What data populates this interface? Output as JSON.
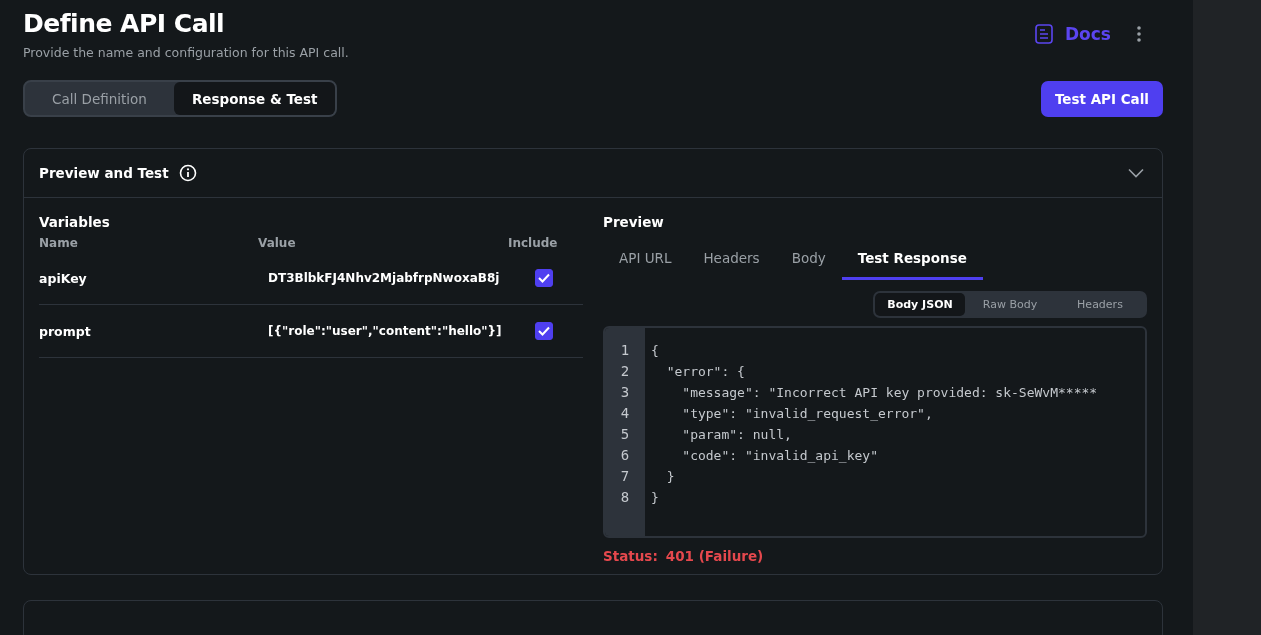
{
  "header": {
    "title": "Define API Call",
    "subtitle": "Provide the name and configuration for this API call.",
    "docs_link": "Docs"
  },
  "mode_tabs": [
    {
      "label": "Call Definition",
      "selected": false
    },
    {
      "label": "Response & Test",
      "selected": true
    }
  ],
  "test_button": "Test API Call",
  "preview_card": {
    "title": "Preview and Test",
    "expanded": true,
    "variables": {
      "title": "Variables",
      "columns": [
        "Name",
        "Value",
        "Include"
      ],
      "rows": [
        {
          "name": "apiKey",
          "value": "DT3BlbkFJ4Nhv2MjabfrpNwoxaB8j",
          "checked": true
        },
        {
          "name": "prompt",
          "value": "[{\"role\":\"user\",\"content\":\"hello\"}]",
          "checked": true
        }
      ]
    },
    "preview": {
      "title": "Preview",
      "tabs": [
        {
          "label": "API URL",
          "selected": false
        },
        {
          "label": "Headers",
          "selected": false
        },
        {
          "label": "Body",
          "selected": false
        },
        {
          "label": "Test Response",
          "selected": true
        }
      ],
      "view_options": [
        {
          "label": "Body JSON",
          "selected": true
        },
        {
          "label": "Raw Body",
          "selected": false
        },
        {
          "label": "Headers",
          "selected": false
        }
      ],
      "code_lines": [
        {
          "number": "1",
          "text": "{"
        },
        {
          "number": "2",
          "text": "  \"error\": {"
        },
        {
          "number": "3",
          "text": "    \"message\": \"Incorrect API key provided: sk-SeWvM*****"
        },
        {
          "number": "4",
          "text": "    \"type\": \"invalid_request_error\","
        },
        {
          "number": "5",
          "text": "    \"param\": null,"
        },
        {
          "number": "6",
          "text": "    \"code\": \"invalid_api_key\""
        },
        {
          "number": "7",
          "text": "  }"
        },
        {
          "number": "8",
          "text": "}"
        }
      ],
      "status_label": "Status:",
      "status_value": "401 (Failure)"
    }
  }
}
